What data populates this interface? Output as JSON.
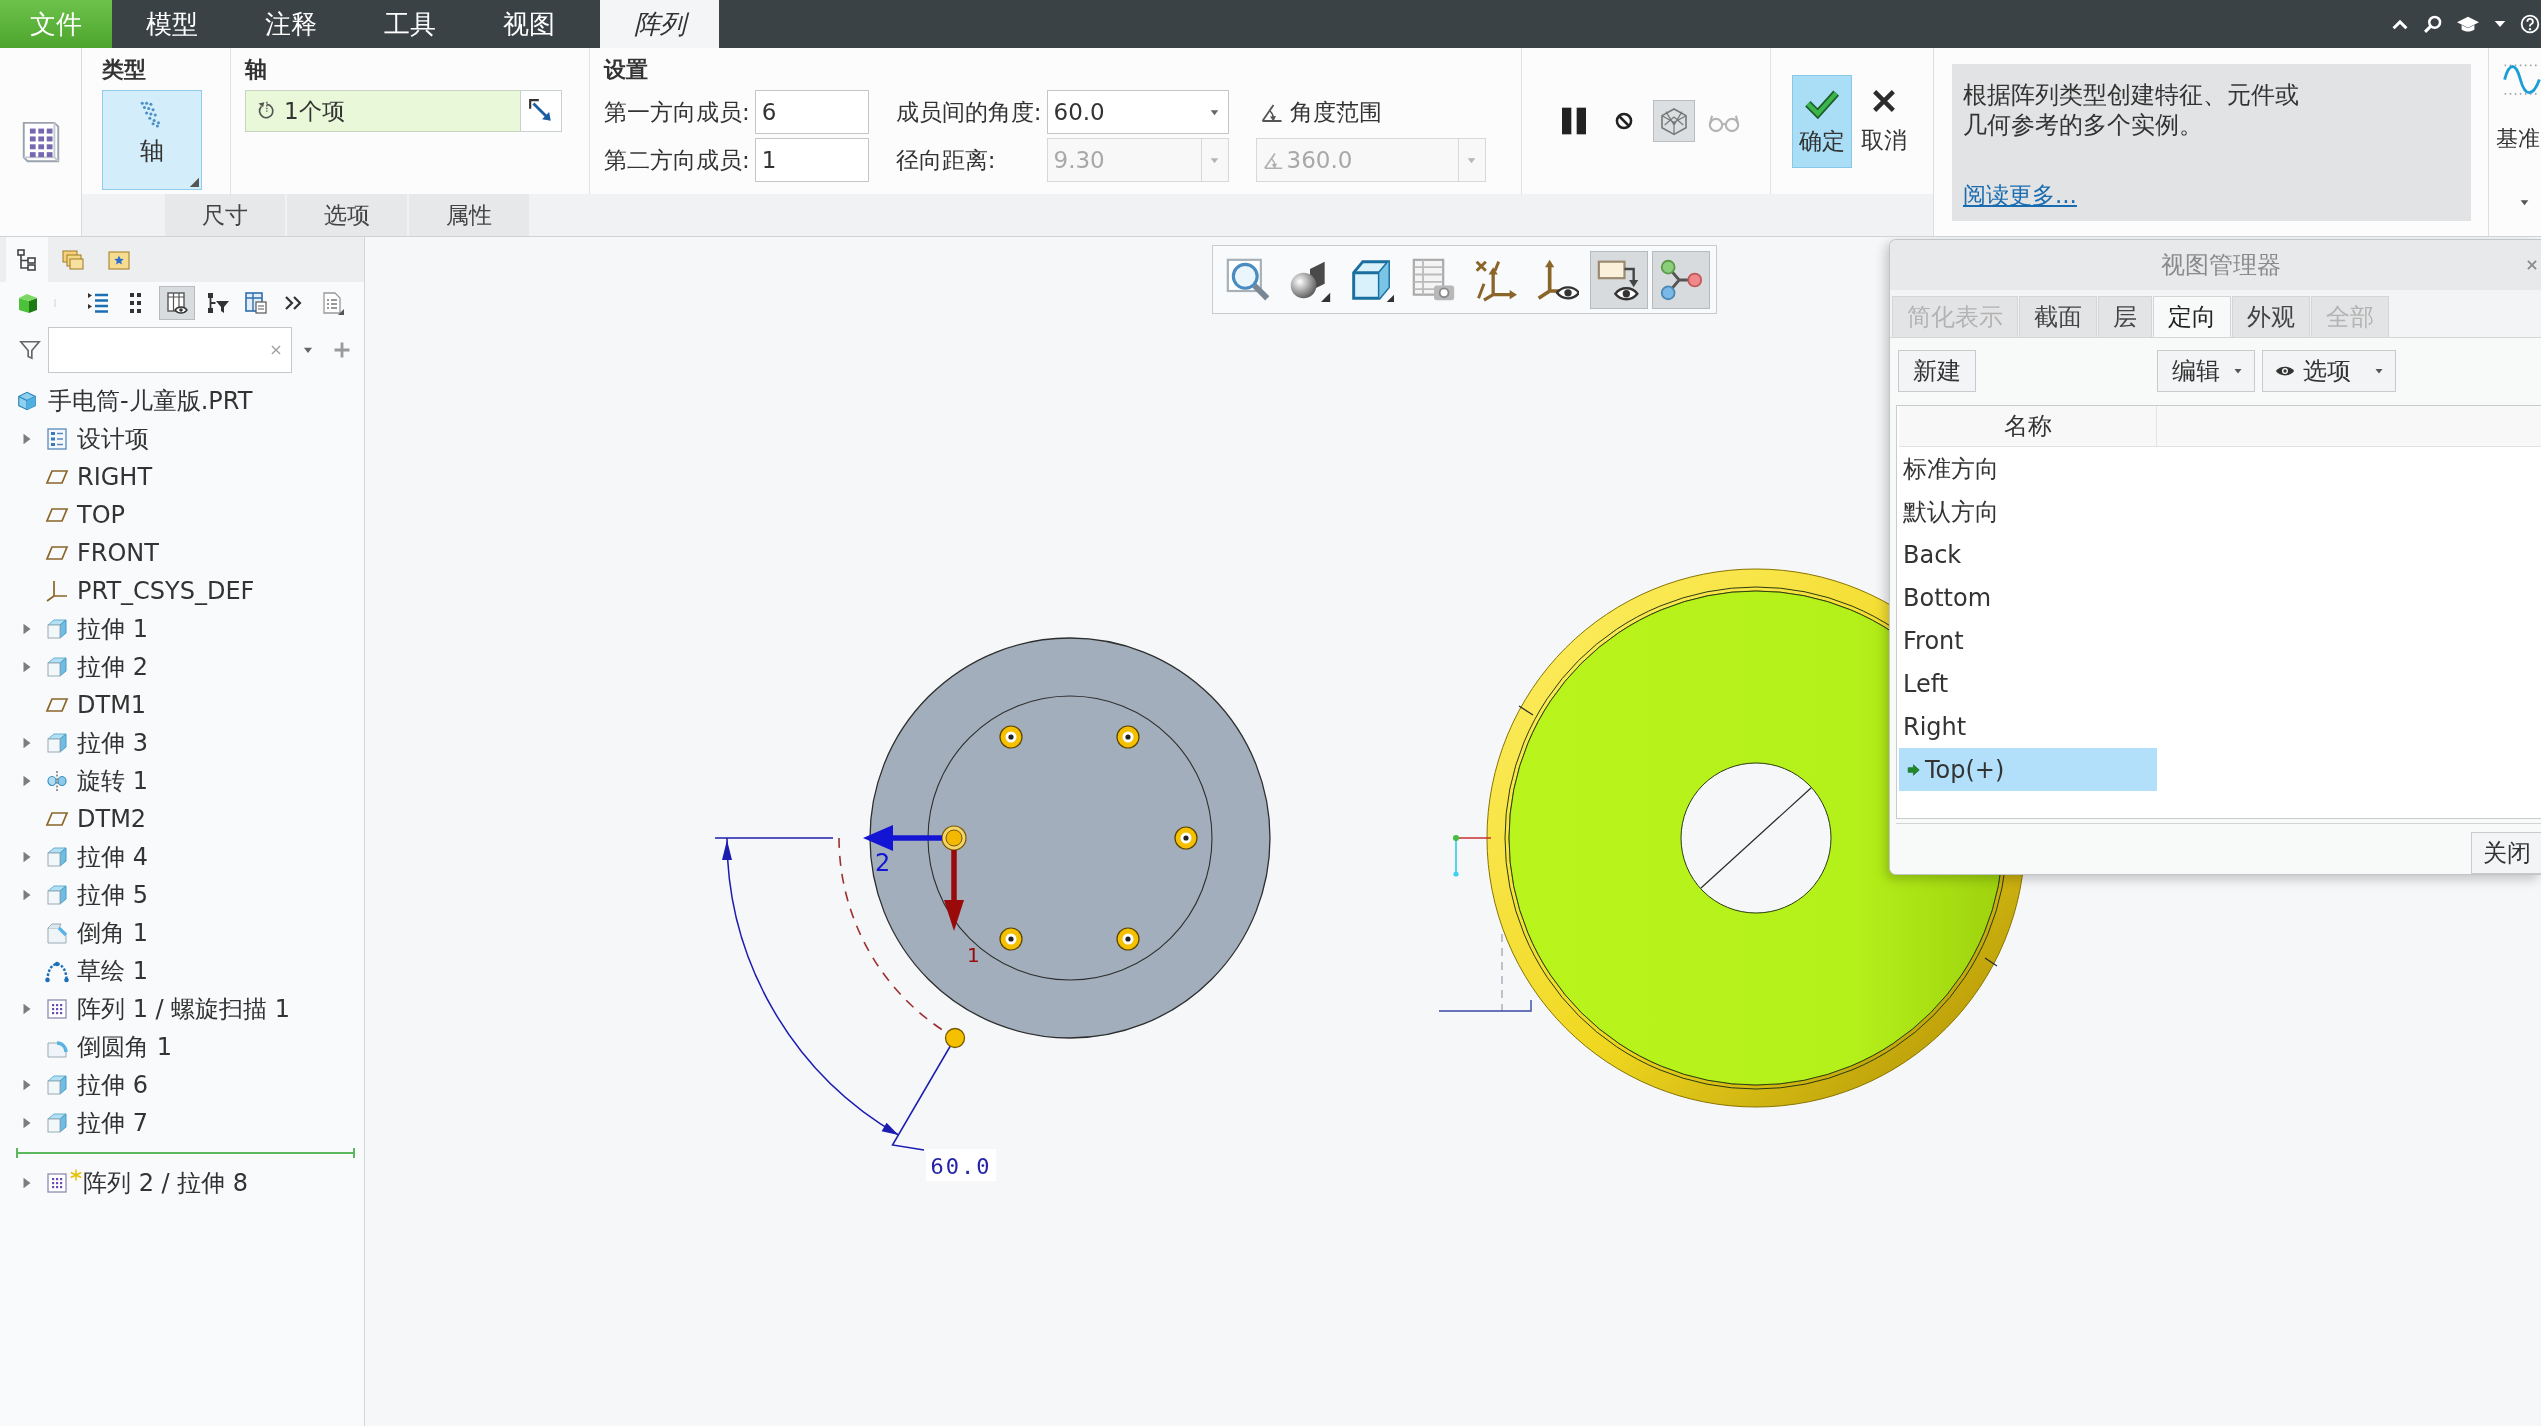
{
  "menu_bar": {
    "tabs": [
      {
        "label": "文件",
        "kind": "file",
        "selected": false
      },
      {
        "label": "模型",
        "kind": "tab",
        "selected": false
      },
      {
        "label": "注释",
        "kind": "tab",
        "selected": false
      },
      {
        "label": "工具",
        "kind": "tab",
        "selected": false
      },
      {
        "label": "视图",
        "kind": "tab",
        "selected": false
      },
      {
        "label": "阵列",
        "kind": "contextual",
        "selected": true
      }
    ]
  },
  "ribbon": {
    "type_group": {
      "title": "类型",
      "option": {
        "label": "轴",
        "selected": true
      }
    },
    "axis_group": {
      "title": "轴",
      "collector": {
        "value": "1个项"
      }
    },
    "settings_group": {
      "title": "设置",
      "columns": [
        [
          {
            "label": "第一方向成员:",
            "value": "6",
            "kind": "spin",
            "disabled": false
          },
          {
            "label": "第二方向成员:",
            "value": "1",
            "kind": "spin",
            "disabled": false
          }
        ],
        [
          {
            "label": "成员间的角度:",
            "value": "60.0",
            "kind": "dropdown",
            "disabled": false
          },
          {
            "label": "径向距离:",
            "value": "9.30",
            "kind": "dropdown",
            "disabled": true
          }
        ],
        [
          {
            "label": "角度范围",
            "value": "360.0",
            "kind": "extent",
            "disabled": true
          }
        ]
      ]
    },
    "preview_tools": [
      {
        "kind": "pause",
        "on": false,
        "disabled": false
      },
      {
        "kind": "no-preview",
        "on": false,
        "disabled": false
      },
      {
        "kind": "geometry-preview",
        "on": true,
        "disabled": false
      },
      {
        "kind": "verify",
        "on": false,
        "disabled": true
      }
    ],
    "ok_button": {
      "label": "确定"
    },
    "cancel_button": {
      "label": "取消"
    },
    "help": {
      "text": "根据阵列类型创建特征、元件或几何参考的多个实例。",
      "link": "阅读更多..."
    },
    "datum_group": {
      "label": "基准"
    },
    "panel_tabs": [
      {
        "label": "尺寸",
        "selected": false
      },
      {
        "label": "选项",
        "selected": false
      },
      {
        "label": "属性",
        "selected": false
      }
    ]
  },
  "model_tree": {
    "tabs": [
      {
        "kind": "tree",
        "selected": true
      },
      {
        "kind": "folders",
        "selected": false
      },
      {
        "kind": "favorites",
        "selected": false
      }
    ],
    "toolbar": [
      {
        "kind": "display",
        "on": false
      },
      {
        "kind": "expand",
        "on": false
      },
      {
        "kind": "collapse",
        "on": false
      },
      {
        "kind": "details",
        "on": true
      },
      {
        "kind": "filter",
        "on": false
      },
      {
        "kind": "columns",
        "on": false
      },
      {
        "kind": "more",
        "on": false
      },
      {
        "kind": "settings",
        "on": false
      }
    ],
    "root": {
      "label": "手电筒-儿童版.PRT",
      "kind": "part",
      "children": [
        {
          "label": "设计项",
          "kind": "design-items",
          "expandable": true
        },
        {
          "label": "RIGHT",
          "kind": "plane",
          "expandable": false
        },
        {
          "label": "TOP",
          "kind": "plane",
          "expandable": false
        },
        {
          "label": "FRONT",
          "kind": "plane",
          "expandable": false
        },
        {
          "label": "PRT_CSYS_DEF",
          "kind": "csys",
          "expandable": false
        },
        {
          "label": "拉伸 1",
          "kind": "extrude",
          "expandable": true
        },
        {
          "label": "拉伸 2",
          "kind": "extrude",
          "expandable": true
        },
        {
          "label": "DTM1",
          "kind": "plane",
          "expandable": false
        },
        {
          "label": "拉伸 3",
          "kind": "extrude",
          "expandable": true
        },
        {
          "label": "旋转 1",
          "kind": "revolve",
          "expandable": true
        },
        {
          "label": "DTM2",
          "kind": "plane",
          "expandable": false
        },
        {
          "label": "拉伸 4",
          "kind": "extrude",
          "expandable": true
        },
        {
          "label": "拉伸 5",
          "kind": "extrude",
          "expandable": true
        },
        {
          "label": "倒角 1",
          "kind": "chamfer",
          "expandable": false
        },
        {
          "label": "草绘 1",
          "kind": "sketch",
          "expandable": false
        },
        {
          "label": "阵列 1 / 螺旋扫描 1",
          "kind": "pattern",
          "expandable": true
        },
        {
          "label": "倒圆角 1",
          "kind": "round",
          "expandable": false
        },
        {
          "label": "拉伸 6",
          "kind": "extrude",
          "expandable": true
        },
        {
          "label": "拉伸 7",
          "kind": "extrude",
          "expandable": true
        },
        {
          "kind": "insert-marker"
        },
        {
          "label": "阵列 2 / 拉伸 8",
          "kind": "pattern-new",
          "expandable": true
        }
      ]
    }
  },
  "graphics": {
    "toolbar": [
      {
        "kind": "refit",
        "on": false
      },
      {
        "kind": "display-style",
        "on": false
      },
      {
        "kind": "saved-orientations",
        "on": false
      },
      {
        "kind": "view-manager",
        "on": false
      },
      {
        "kind": "datum-display",
        "on": false
      },
      {
        "kind": "spin-center",
        "on": false
      },
      {
        "kind": "annotation-display",
        "on": true
      },
      {
        "kind": "appearance",
        "on": true
      }
    ],
    "preview": {
      "direction_labels": [
        "2",
        "1"
      ],
      "dimension": "60.0"
    }
  },
  "view_manager": {
    "title": "视图管理器",
    "tabs": [
      {
        "label": "简化表示",
        "selected": false,
        "disabled": true
      },
      {
        "label": "截面",
        "selected": false,
        "disabled": false
      },
      {
        "label": "层",
        "selected": false,
        "disabled": false
      },
      {
        "label": "定向",
        "selected": true,
        "disabled": false
      },
      {
        "label": "外观",
        "selected": false,
        "disabled": false
      },
      {
        "label": "全部",
        "selected": false,
        "disabled": true
      }
    ],
    "new_button": "新建",
    "edit_menu": "编辑",
    "options_menu": "选项",
    "column": "名称",
    "views": [
      {
        "label": "标准方向",
        "selected": false,
        "active": false
      },
      {
        "label": "默认方向",
        "selected": false,
        "active": false
      },
      {
        "label": "Back",
        "selected": false,
        "active": false
      },
      {
        "label": "Bottom",
        "selected": false,
        "active": false
      },
      {
        "label": "Front",
        "selected": false,
        "active": false
      },
      {
        "label": "Left",
        "selected": false,
        "active": false
      },
      {
        "label": "Right",
        "selected": false,
        "active": false
      },
      {
        "label": "Top(+)",
        "selected": true,
        "active": true
      }
    ],
    "close_button": "关闭"
  }
}
